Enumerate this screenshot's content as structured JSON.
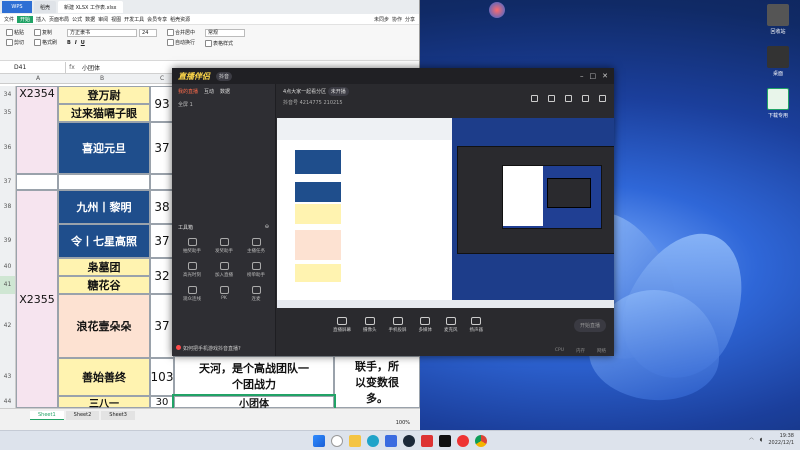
{
  "excel": {
    "tabs": [
      "稻壳",
      "新建 XLSX 工作表.xlsx"
    ],
    "menus": [
      "文件",
      "开始",
      "插入",
      "页面布局",
      "公式",
      "数据",
      "审阅",
      "视图",
      "开发工具",
      "会员专享",
      "稻壳资源"
    ],
    "ribbon": {
      "paste": "粘贴",
      "cut": "剪切",
      "copy": "复制",
      "format_painter": "格式刷",
      "font": "方正隶书",
      "font_size": "24",
      "merge": "合并居中",
      "wrap": "自动换行",
      "currency": "常规",
      "cell_style": "表格样式"
    },
    "name_box": "D41",
    "fx": "fx",
    "formula_value": "小团体",
    "share": "分享",
    "sync": "未同步",
    "collab": "协作",
    "col_headers": [
      "A",
      "B",
      "C",
      "D",
      "E"
    ],
    "row_numbers": [
      "34",
      "35",
      "36",
      "37",
      "38",
      "39",
      "40",
      "41",
      "42",
      "43",
      "44"
    ],
    "cells": {
      "a_group_1": "X2354",
      "a_group_2": "X2355",
      "b34": "登万尉",
      "b35": "过来猫嗝子眼",
      "b36": "喜迎元旦",
      "b38": "九州丨黎明",
      "b39": "令丨七星高照",
      "b40": "枭墓团",
      "b41": "糖花谷",
      "b42": "浪花壹朵朵",
      "b43": "善始善终",
      "b44": "三八一",
      "c34": "93",
      "c36": "37",
      "c38": "38",
      "c39": "37",
      "c41": "32",
      "c42": "37",
      "c43": "103",
      "c44": "30",
      "d43a": "联手，所",
      "d43b": "天河，是个高战团队一",
      "d43c": "以变数很",
      "d43d": "个团战力",
      "d43e": "多。",
      "d44": "小团体"
    },
    "sheets": [
      "Sheet1",
      "Sheet2",
      "Sheet3"
    ],
    "zoom": "100%"
  },
  "stream": {
    "logo_main": "直播伴侣",
    "logo_badge": "抖音",
    "left_tabs": [
      "我的直播",
      "互动",
      "数据"
    ],
    "scene": "全屏 1",
    "tools_title": "工具箱",
    "tools": [
      "抽奖助手",
      "发奖助手",
      "主播任务",
      "高光时刻",
      "加入直播",
      "榜单助手",
      "观众连线",
      "PK",
      "连麦"
    ],
    "tip": "如何把手机游戏抖音直播?",
    "room_title": "4点大家一起看分区",
    "room_status": "未开播",
    "room_meta": "抖音号 4214775",
    "room_fans": "210215",
    "controls": [
      "直播屏幕",
      "摄像头",
      "手机投屏",
      "多媒体",
      "麦克风",
      "扬声器"
    ],
    "go_live": "开始直播",
    "bottom": [
      "CPU",
      "内存",
      "网络"
    ]
  },
  "taskbar": {
    "time": "19:38",
    "date": "2022/12/1"
  },
  "desktop_icons": [
    "回收站",
    "桌面",
    "下载专用"
  ]
}
